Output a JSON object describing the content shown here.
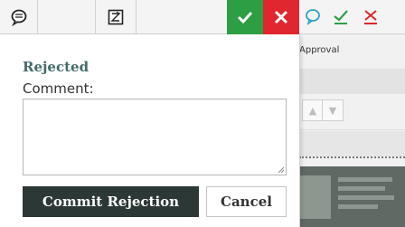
{
  "toolbar": {
    "items": [
      {
        "icon": "comment-bubble-icon"
      },
      {
        "icon": "zoom-box-icon"
      },
      {
        "icon": "confirm-check-icon",
        "color": "#2e9e45"
      },
      {
        "icon": "reject-x-icon",
        "color": "#e0262e"
      },
      {
        "icon": "comment-outline-icon",
        "color": "#2aa5c9"
      },
      {
        "icon": "approve-check-icon",
        "color": "#2e9e45"
      },
      {
        "icon": "reject-x-outline-icon",
        "color": "#e0262e"
      }
    ]
  },
  "background": {
    "approval_label": "Approval",
    "nav_up": "▲",
    "nav_down": "▼"
  },
  "panel": {
    "title": "Rejected",
    "comment_label": "Comment:",
    "comment_value": "",
    "commit_label": "Commit Rejection",
    "cancel_label": "Cancel"
  },
  "colors": {
    "title": "#456b6b",
    "commit_bg": "#2c3836",
    "accept_green": "#2e9e45",
    "reject_red": "#e0262e"
  }
}
